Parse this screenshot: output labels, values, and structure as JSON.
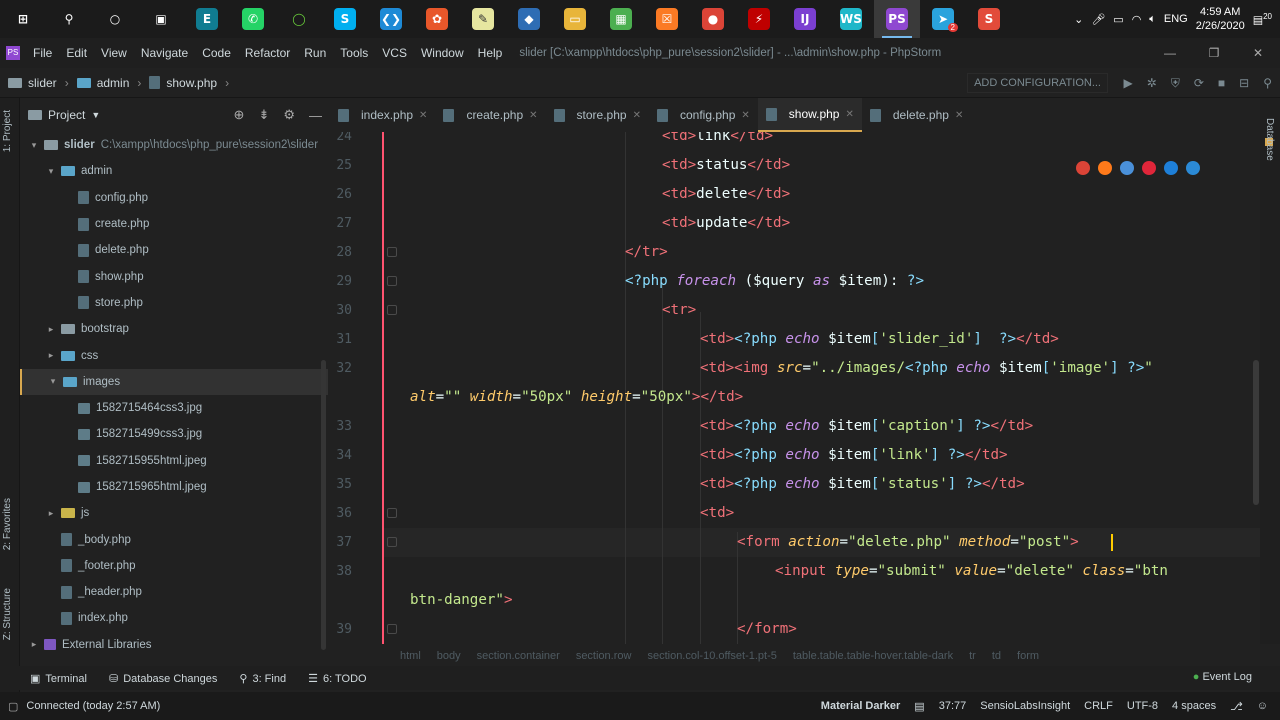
{
  "taskbar": {
    "apps": [
      {
        "name": "windows-start-icon",
        "glyph": "⊞",
        "color": "#ffffff",
        "bg": "transparent"
      },
      {
        "name": "search-icon",
        "glyph": "⚲",
        "color": "#ffffff",
        "bg": "transparent"
      },
      {
        "name": "cortana-icon",
        "glyph": "○",
        "color": "#ffffff",
        "bg": "transparent"
      },
      {
        "name": "task-view-icon",
        "glyph": "▣",
        "color": "#ffffff",
        "bg": "transparent"
      },
      {
        "name": "app-teal-icon",
        "glyph": "E",
        "color": "#ffffff",
        "bg": "#107c91"
      },
      {
        "name": "whatsapp-icon",
        "glyph": "✆",
        "color": "#ffffff",
        "bg": "#25d366"
      },
      {
        "name": "green-ring-icon",
        "glyph": "◯",
        "color": "#6ad13b",
        "bg": "transparent"
      },
      {
        "name": "skype-icon",
        "glyph": "S",
        "color": "#ffffff",
        "bg": "#00aff0"
      },
      {
        "name": "vscode-icon",
        "glyph": "❮❯",
        "color": "#ffffff",
        "bg": "#1e8ad6"
      },
      {
        "name": "colorful-app-icon",
        "glyph": "✿",
        "color": "#ffffff",
        "bg": "#e8572a"
      },
      {
        "name": "notepad-icon",
        "glyph": "✎",
        "color": "#333333",
        "bg": "#e6e6a0"
      },
      {
        "name": "virtualbox-icon",
        "glyph": "◆",
        "color": "#ffffff",
        "bg": "#2e6db4"
      },
      {
        "name": "file-explorer-icon",
        "glyph": "▭",
        "color": "#ffffff",
        "bg": "#e8b53a"
      },
      {
        "name": "store-icon",
        "glyph": "▦",
        "color": "#ffffff",
        "bg": "#4caf50"
      },
      {
        "name": "xampp-icon",
        "glyph": "☒",
        "color": "#ffffff",
        "bg": "#fb7a24"
      },
      {
        "name": "chrome-icon",
        "glyph": "●",
        "color": "#ffffff",
        "bg": "#db4437"
      },
      {
        "name": "filezilla-icon",
        "glyph": "⚡",
        "color": "#ffffff",
        "bg": "#bf0000"
      },
      {
        "name": "intellij-icon",
        "glyph": "IJ",
        "color": "#ffffff",
        "bg": "#7b3fd1"
      },
      {
        "name": "webstorm-icon",
        "glyph": "WS",
        "color": "#ffffff",
        "bg": "#1fb7c9"
      },
      {
        "name": "phpstorm-icon",
        "glyph": "PS",
        "color": "#ffffff",
        "bg": "#8f48d1",
        "active": true
      },
      {
        "name": "telegram-icon",
        "glyph": "➤",
        "color": "#ffffff",
        "bg": "#2aa3dd",
        "badge": "2"
      },
      {
        "name": "red-app-icon",
        "glyph": "S",
        "color": "#ffffff",
        "bg": "#e24b3a"
      }
    ],
    "time": "4:59 AM",
    "date": "2/26/2020",
    "lang": "ENG",
    "notif_count": "20"
  },
  "menubar": {
    "items": [
      "File",
      "Edit",
      "View",
      "Navigate",
      "Code",
      "Refactor",
      "Run",
      "Tools",
      "VCS",
      "Window",
      "Help"
    ],
    "title": "slider [C:\\xampp\\htdocs\\php_pure\\session2\\slider] - ...\\admin\\show.php - PhpStorm"
  },
  "navbar": {
    "crumbs": [
      "slider",
      "admin",
      "show.php"
    ],
    "add_config": "ADD CONFIGURATION..."
  },
  "leftstrip": {
    "project": "1: Project",
    "favorites": "2: Favorites",
    "structure": "Z: Structure"
  },
  "project": {
    "title": "Project",
    "tree": [
      {
        "label": "slider",
        "path": "C:\\xampp\\htdocs\\php_pure\\session2\\slider",
        "depth": 0,
        "type": "folder",
        "arrow": "▾"
      },
      {
        "label": "admin",
        "depth": 1,
        "type": "folder-blue",
        "arrow": "▾"
      },
      {
        "label": "config.php",
        "depth": 2,
        "type": "php"
      },
      {
        "label": "create.php",
        "depth": 2,
        "type": "php"
      },
      {
        "label": "delete.php",
        "depth": 2,
        "type": "php"
      },
      {
        "label": "show.php",
        "depth": 2,
        "type": "php"
      },
      {
        "label": "store.php",
        "depth": 2,
        "type": "php"
      },
      {
        "label": "bootstrap",
        "depth": 1,
        "type": "folder",
        "arrow": "▸"
      },
      {
        "label": "css",
        "depth": 1,
        "type": "folder-blue",
        "arrow": "▸"
      },
      {
        "label": "images",
        "depth": 1,
        "type": "folder-blue",
        "arrow": "▾",
        "selected": true
      },
      {
        "label": "1582715464css3.jpg",
        "depth": 2,
        "type": "img"
      },
      {
        "label": "1582715499css3.jpg",
        "depth": 2,
        "type": "img"
      },
      {
        "label": "1582715955html.jpeg",
        "depth": 2,
        "type": "img"
      },
      {
        "label": "1582715965html.jpeg",
        "depth": 2,
        "type": "img"
      },
      {
        "label": "js",
        "depth": 1,
        "type": "folder-yellow",
        "arrow": "▸"
      },
      {
        "label": "_body.php",
        "depth": 1,
        "type": "php"
      },
      {
        "label": "_footer.php",
        "depth": 1,
        "type": "php"
      },
      {
        "label": "_header.php",
        "depth": 1,
        "type": "php"
      },
      {
        "label": "index.php",
        "depth": 1,
        "type": "php"
      },
      {
        "label": "External Libraries",
        "depth": 0,
        "type": "lib",
        "arrow": "▸"
      }
    ]
  },
  "tabs": [
    {
      "label": "index.php"
    },
    {
      "label": "create.php"
    },
    {
      "label": "store.php"
    },
    {
      "label": "config.php"
    },
    {
      "label": "show.php",
      "active": true
    },
    {
      "label": "delete.php"
    }
  ],
  "editor": {
    "lines": [
      {
        "n": "24",
        "indent": 332,
        "tokens": [
          [
            "t",
            "<td>"
          ],
          [
            "pl",
            "link"
          ],
          [
            "t",
            "</td>"
          ]
        ]
      },
      {
        "n": "25",
        "indent": 332,
        "tokens": [
          [
            "t",
            "<td>"
          ],
          [
            "pl",
            "status"
          ],
          [
            "t",
            "</td>"
          ]
        ]
      },
      {
        "n": "26",
        "indent": 332,
        "tokens": [
          [
            "t",
            "<td>"
          ],
          [
            "pl",
            "delete"
          ],
          [
            "t",
            "</td>"
          ]
        ]
      },
      {
        "n": "27",
        "indent": 332,
        "tokens": [
          [
            "t",
            "<td>"
          ],
          [
            "pl",
            "update"
          ],
          [
            "t",
            "</td>"
          ]
        ]
      },
      {
        "n": "28",
        "indent": 295,
        "tokens": [
          [
            "t",
            "</tr>"
          ]
        ]
      },
      {
        "n": "29",
        "indent": 295,
        "tokens": [
          [
            "p",
            "<?php "
          ],
          [
            "k",
            "foreach "
          ],
          [
            "v",
            "("
          ],
          [
            "pl",
            "$query "
          ],
          [
            "k",
            "as "
          ],
          [
            "pl",
            "$item"
          ],
          [
            "v",
            "): "
          ],
          [
            "p",
            "?>"
          ]
        ]
      },
      {
        "n": "30",
        "indent": 332,
        "tokens": [
          [
            "t",
            "<tr>"
          ]
        ]
      },
      {
        "n": "31",
        "indent": 370,
        "tokens": [
          [
            "t",
            "<td>"
          ],
          [
            "p",
            "<?php "
          ],
          [
            "k",
            "echo "
          ],
          [
            "pl",
            "$item"
          ],
          [
            "p",
            "["
          ],
          [
            "s",
            "'slider_id'"
          ],
          [
            "p",
            "]  "
          ],
          [
            "p",
            "?>"
          ],
          [
            "t",
            "</td>"
          ]
        ]
      },
      {
        "n": "32",
        "indent": 370,
        "tokens": [
          [
            "t",
            "<td>"
          ],
          [
            "t",
            "<img "
          ],
          [
            "a",
            "src"
          ],
          [
            "v",
            "="
          ],
          [
            "s",
            "\"../images/"
          ],
          [
            "p",
            "<?php "
          ],
          [
            "k",
            "echo "
          ],
          [
            "pl",
            "$item"
          ],
          [
            "p",
            "["
          ],
          [
            "s",
            "'image'"
          ],
          [
            "p",
            "] "
          ],
          [
            "p",
            "?>"
          ],
          [
            "s",
            "\""
          ]
        ]
      },
      {
        "n": "",
        "indent": 80,
        "tokens": [
          [
            "a",
            "alt"
          ],
          [
            "v",
            "="
          ],
          [
            "s",
            "\"\" "
          ],
          [
            "a",
            "width"
          ],
          [
            "v",
            "="
          ],
          [
            "s",
            "\"50px\" "
          ],
          [
            "a",
            "height"
          ],
          [
            "v",
            "="
          ],
          [
            "s",
            "\"50px\""
          ],
          [
            "t",
            ">"
          ],
          [
            "t",
            "</td>"
          ]
        ]
      },
      {
        "n": "33",
        "indent": 370,
        "tokens": [
          [
            "t",
            "<td>"
          ],
          [
            "p",
            "<?php "
          ],
          [
            "k",
            "echo "
          ],
          [
            "pl",
            "$item"
          ],
          [
            "p",
            "["
          ],
          [
            "s",
            "'caption'"
          ],
          [
            "p",
            "] "
          ],
          [
            "p",
            "?>"
          ],
          [
            "t",
            "</td>"
          ]
        ]
      },
      {
        "n": "34",
        "indent": 370,
        "tokens": [
          [
            "t",
            "<td>"
          ],
          [
            "p",
            "<?php "
          ],
          [
            "k",
            "echo "
          ],
          [
            "pl",
            "$item"
          ],
          [
            "p",
            "["
          ],
          [
            "s",
            "'link'"
          ],
          [
            "p",
            "] "
          ],
          [
            "p",
            "?>"
          ],
          [
            "t",
            "</td>"
          ]
        ]
      },
      {
        "n": "35",
        "indent": 370,
        "tokens": [
          [
            "t",
            "<td>"
          ],
          [
            "p",
            "<?php "
          ],
          [
            "k",
            "echo "
          ],
          [
            "pl",
            "$item"
          ],
          [
            "p",
            "["
          ],
          [
            "s",
            "'status'"
          ],
          [
            "p",
            "] "
          ],
          [
            "p",
            "?>"
          ],
          [
            "t",
            "</td>"
          ]
        ]
      },
      {
        "n": "36",
        "indent": 370,
        "tokens": [
          [
            "t",
            "<td>"
          ]
        ]
      },
      {
        "n": "37",
        "indent": 407,
        "tokens": [
          [
            "t",
            "<form "
          ],
          [
            "a",
            "action"
          ],
          [
            "v",
            "="
          ],
          [
            "s",
            "\"delete.php\" "
          ],
          [
            "a",
            "method"
          ],
          [
            "v",
            "="
          ],
          [
            "s",
            "\"post\""
          ],
          [
            "t",
            ">"
          ]
        ]
      },
      {
        "n": "38",
        "indent": 445,
        "tokens": [
          [
            "t",
            "<input "
          ],
          [
            "a",
            "type"
          ],
          [
            "v",
            "="
          ],
          [
            "s",
            "\"submit\" "
          ],
          [
            "a",
            "value"
          ],
          [
            "v",
            "="
          ],
          [
            "s",
            "\"delete\" "
          ],
          [
            "a",
            "class"
          ],
          [
            "v",
            "="
          ],
          [
            "s",
            "\"btn"
          ]
        ]
      },
      {
        "n": "",
        "indent": 80,
        "tokens": [
          [
            "s",
            "btn-danger\""
          ],
          [
            "t",
            ">"
          ]
        ]
      },
      {
        "n": "39",
        "indent": 407,
        "tokens": [
          [
            "t",
            "</form>"
          ]
        ]
      }
    ]
  },
  "breadcrumbs": [
    "html",
    "body",
    "section.container",
    "section.row",
    "section.col-10.offset-1.pt-5",
    "table.table.table-hover.table-dark",
    "tr",
    "td",
    "form"
  ],
  "toolwindows": [
    {
      "label": "Terminal",
      "icon": "▣"
    },
    {
      "label": "Database Changes",
      "icon": "⛁"
    },
    {
      "label": "3: Find",
      "icon": "⚲"
    },
    {
      "label": "6: TODO",
      "icon": "☰"
    }
  ],
  "event_log": "Event Log",
  "status": {
    "left": "Connected (today 2:57 AM)",
    "theme": "Material Darker",
    "position": "37:77",
    "plugin": "SensioLabsInsight",
    "line_sep": "CRLF",
    "encoding": "UTF-8",
    "indent": "4 spaces"
  },
  "colors": {
    "tag": "#f07178",
    "php": "#89ddff",
    "keyword": "#c792ea",
    "attr": "#ffcb6b",
    "string": "#c3e88d",
    "accent": "#d8a84f"
  }
}
